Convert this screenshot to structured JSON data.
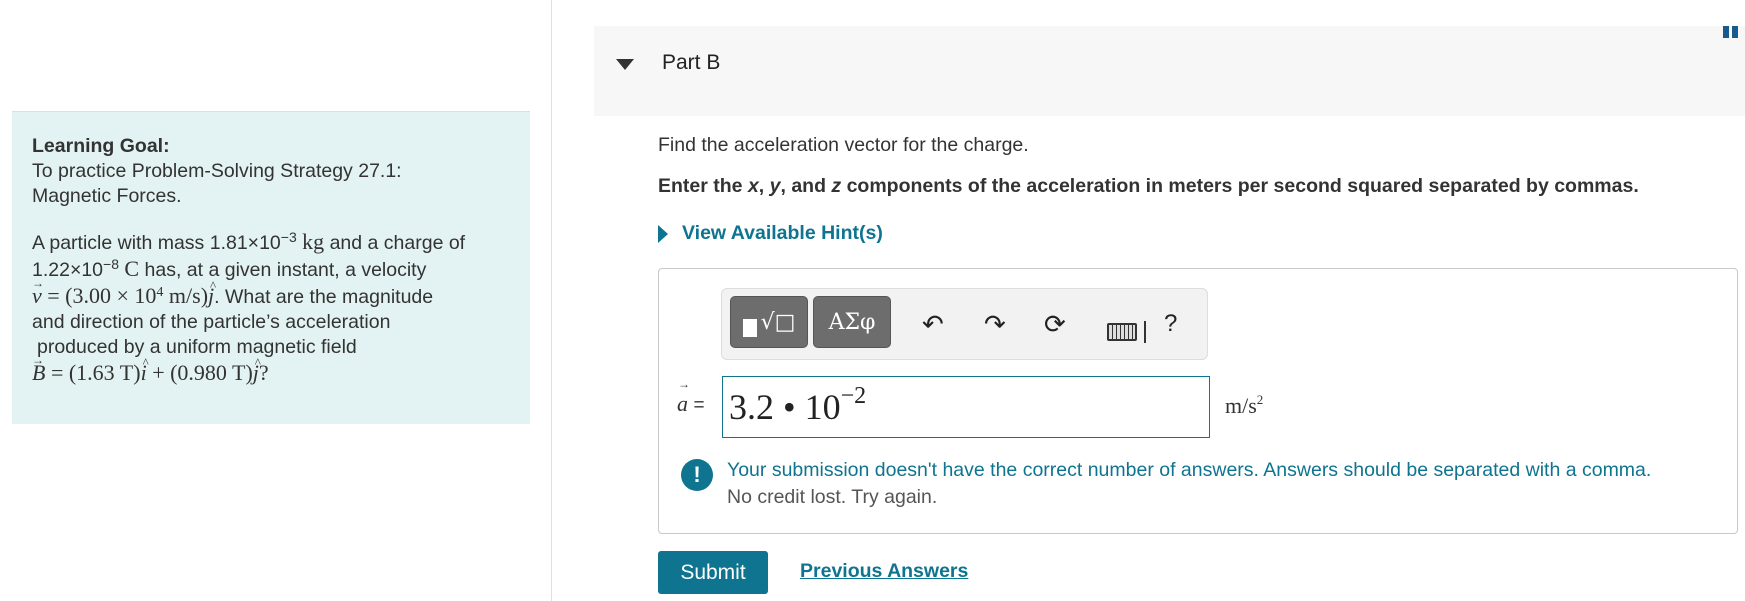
{
  "left_panel": {
    "goal_title": "Learning Goal:",
    "goal_text_1": "To practice Problem-Solving Strategy 27.1:",
    "goal_text_2": "Magnetic Forces.",
    "problem": {
      "mass_prefix": "A particle with mass 1.81×10",
      "mass_exp": "−3",
      "mass_unit": "kg",
      "mass_suffix": " and a charge of",
      "charge_prefix": "1.22×10",
      "charge_exp": "−8",
      "charge_unit": "C",
      "charge_suffix": " has, at a given instant, a velocity",
      "velocity_eq": "= (3.00 × 10",
      "velocity_exp": "4",
      "velocity_unit": " m/s)",
      "velocity_suffix": ". What are the magnitude",
      "line4": "and direction of the particle’s acceleration",
      "line5": "produced by a uniform magnetic field",
      "field_eq_1": "= (1.63 T)",
      "field_eq_2": " + (0.980 T)",
      "field_eq_end": "?"
    }
  },
  "part": {
    "title": "Part B",
    "question": "Find the acceleration vector for the charge.",
    "instruction_1": "Enter the ",
    "instruction_x": "x",
    "instruction_sep1": ", ",
    "instruction_y": "y",
    "instruction_sep2": ", and ",
    "instruction_z": "z",
    "instruction_2": " components of the acceleration in meters per second squared separated by commas.",
    "hint_label": "View Available Hint(s)"
  },
  "toolbar": {
    "greek_label": "ΑΣφ",
    "templates_symbol": "√□",
    "help_label": "?"
  },
  "answer": {
    "var_symbol": "a",
    "equals": "=",
    "value_base": "3.2 • 10",
    "value_exp": "−2",
    "unit_base": "m/s",
    "unit_exp": "2"
  },
  "feedback": {
    "main": "Your submission doesn't have the correct number of answers. Answers should be separated with a comma.",
    "sub": "No credit lost. Try again."
  },
  "actions": {
    "submit_label": "Submit",
    "previous_label": "Previous Answers"
  },
  "colors": {
    "accent": "#0e7490",
    "goal_bg": "#e3f2f2",
    "header_bg": "#f7f7f7"
  }
}
